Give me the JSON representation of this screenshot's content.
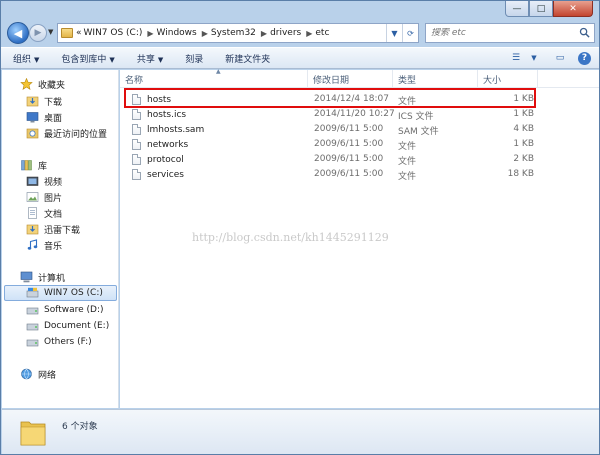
{
  "window": {
    "caption_buttons": {
      "minimize": "—",
      "maximize": "□",
      "close": "✕"
    }
  },
  "nav": {
    "back_glyph": "◀",
    "forward_glyph": "▶",
    "history_glyph": "▼",
    "breadcrumb_lead": "«",
    "crumbs": [
      "WIN7 OS (C:)",
      "Windows",
      "System32",
      "drivers",
      "etc"
    ],
    "crumb_sep": "▶",
    "addr_dropdown": "▼",
    "refresh_glyph": "⟳",
    "search_placeholder": "搜索 etc"
  },
  "toolbar": {
    "organize": "组织",
    "include_library": "包含到库中",
    "share": "共享",
    "burn": "刻录",
    "new_folder": "新建文件夹",
    "dropdown_glyph": "▼",
    "view_glyph": "☰",
    "preview_glyph": "▭",
    "help_glyph": "?"
  },
  "navpane": {
    "favorites": "收藏夹",
    "downloads": "下载",
    "desktop": "桌面",
    "recent": "最近访问的位置",
    "libraries": "库",
    "videos": "视频",
    "pictures": "图片",
    "documents": "文档",
    "thunder": "迅雷下载",
    "music": "音乐",
    "computer": "计算机",
    "drive_c": "WIN7 OS (C:)",
    "drive_d": "Software (D:)",
    "drive_e": "Document (E:)",
    "drive_f": "Others (F:)",
    "network": "网络"
  },
  "columns": {
    "name": "名称",
    "modified": "修改日期",
    "type": "类型",
    "size": "大小",
    "sort_glyph": "▲"
  },
  "files": [
    {
      "name": "hosts",
      "modified": "2014/12/4 18:07",
      "type": "文件",
      "size": "1 KB"
    },
    {
      "name": "hosts.ics",
      "modified": "2014/11/20 10:27",
      "type": "ICS 文件",
      "size": "1 KB"
    },
    {
      "name": "lmhosts.sam",
      "modified": "2009/6/11 5:00",
      "type": "SAM 文件",
      "size": "4 KB"
    },
    {
      "name": "networks",
      "modified": "2009/6/11 5:00",
      "type": "文件",
      "size": "1 KB"
    },
    {
      "name": "protocol",
      "modified": "2009/6/11 5:00",
      "type": "文件",
      "size": "2 KB"
    },
    {
      "name": "services",
      "modified": "2009/6/11 5:00",
      "type": "文件",
      "size": "18 KB"
    }
  ],
  "watermark": "http://blog.csdn.net/kh1445291129",
  "details": {
    "count": "6 个对象"
  },
  "colors": {
    "highlight": "#e00d0d",
    "frame": "#b9d1ea"
  }
}
